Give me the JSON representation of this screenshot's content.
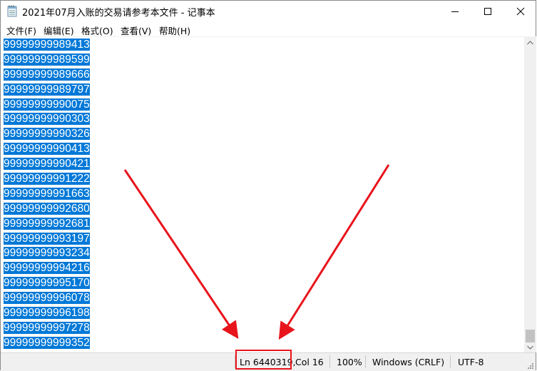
{
  "window": {
    "title": "2021年07月入账的交易请参考本文件 - 记事本"
  },
  "menu": {
    "file": "文件(F)",
    "edit": "编辑(E)",
    "format": "格式(O)",
    "view": "查看(V)",
    "help": "帮助(H)"
  },
  "editor": {
    "lines": [
      "99999999989413",
      "99999999989599",
      "99999999989666",
      "99999999989797",
      "99999999990075",
      "99999999990303",
      "99999999990326",
      "99999999990413",
      "99999999990421",
      "99999999991222",
      "99999999991663",
      "99999999992680",
      "99999999992681",
      "99999999993197",
      "99999999993234",
      "99999999994216",
      "99999999995170",
      "99999999996078",
      "99999999996198",
      "99999999997278",
      "99999999999352"
    ],
    "selection_color": "#0078d7"
  },
  "status": {
    "line": "Ln 6440319,",
    "col": "Col 16",
    "zoom": "100%",
    "line_ending": "Windows (CRLF)",
    "encoding": "UTF-8"
  },
  "annotation": {
    "color": "#e8141c"
  }
}
